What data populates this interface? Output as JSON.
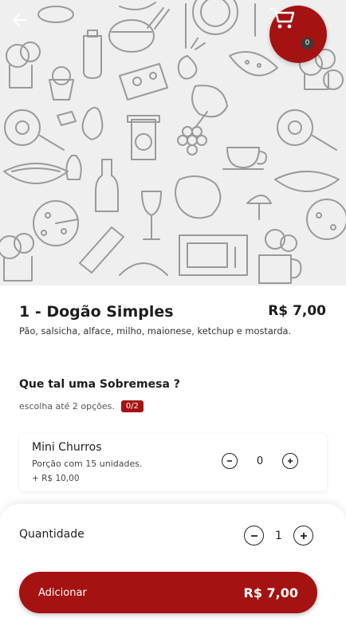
{
  "product": {
    "name": "1 - Dogão Simples",
    "price": "R$ 7,00",
    "description": "Pão, salsicha, alface, milho, maionese, ketchup e mostarda."
  },
  "cart": {
    "count": "0"
  },
  "group": {
    "title": "Que tal uma Sobremesa ?",
    "subtitle": "escolha até 2 opções.",
    "badge": "0/2"
  },
  "option": {
    "name": "Mini Churros",
    "description": "Porção com 15 unidades.",
    "price": "+ R$ 10,00",
    "quantity": "0"
  },
  "footer": {
    "quantity_label": "Quantidade",
    "quantity": "1",
    "add_label": "Adicionar",
    "add_price": "R$ 7,00"
  },
  "colors": {
    "accent": "#a51212",
    "hero_bg": "#efefef",
    "doodle": "#9a9a9a"
  }
}
